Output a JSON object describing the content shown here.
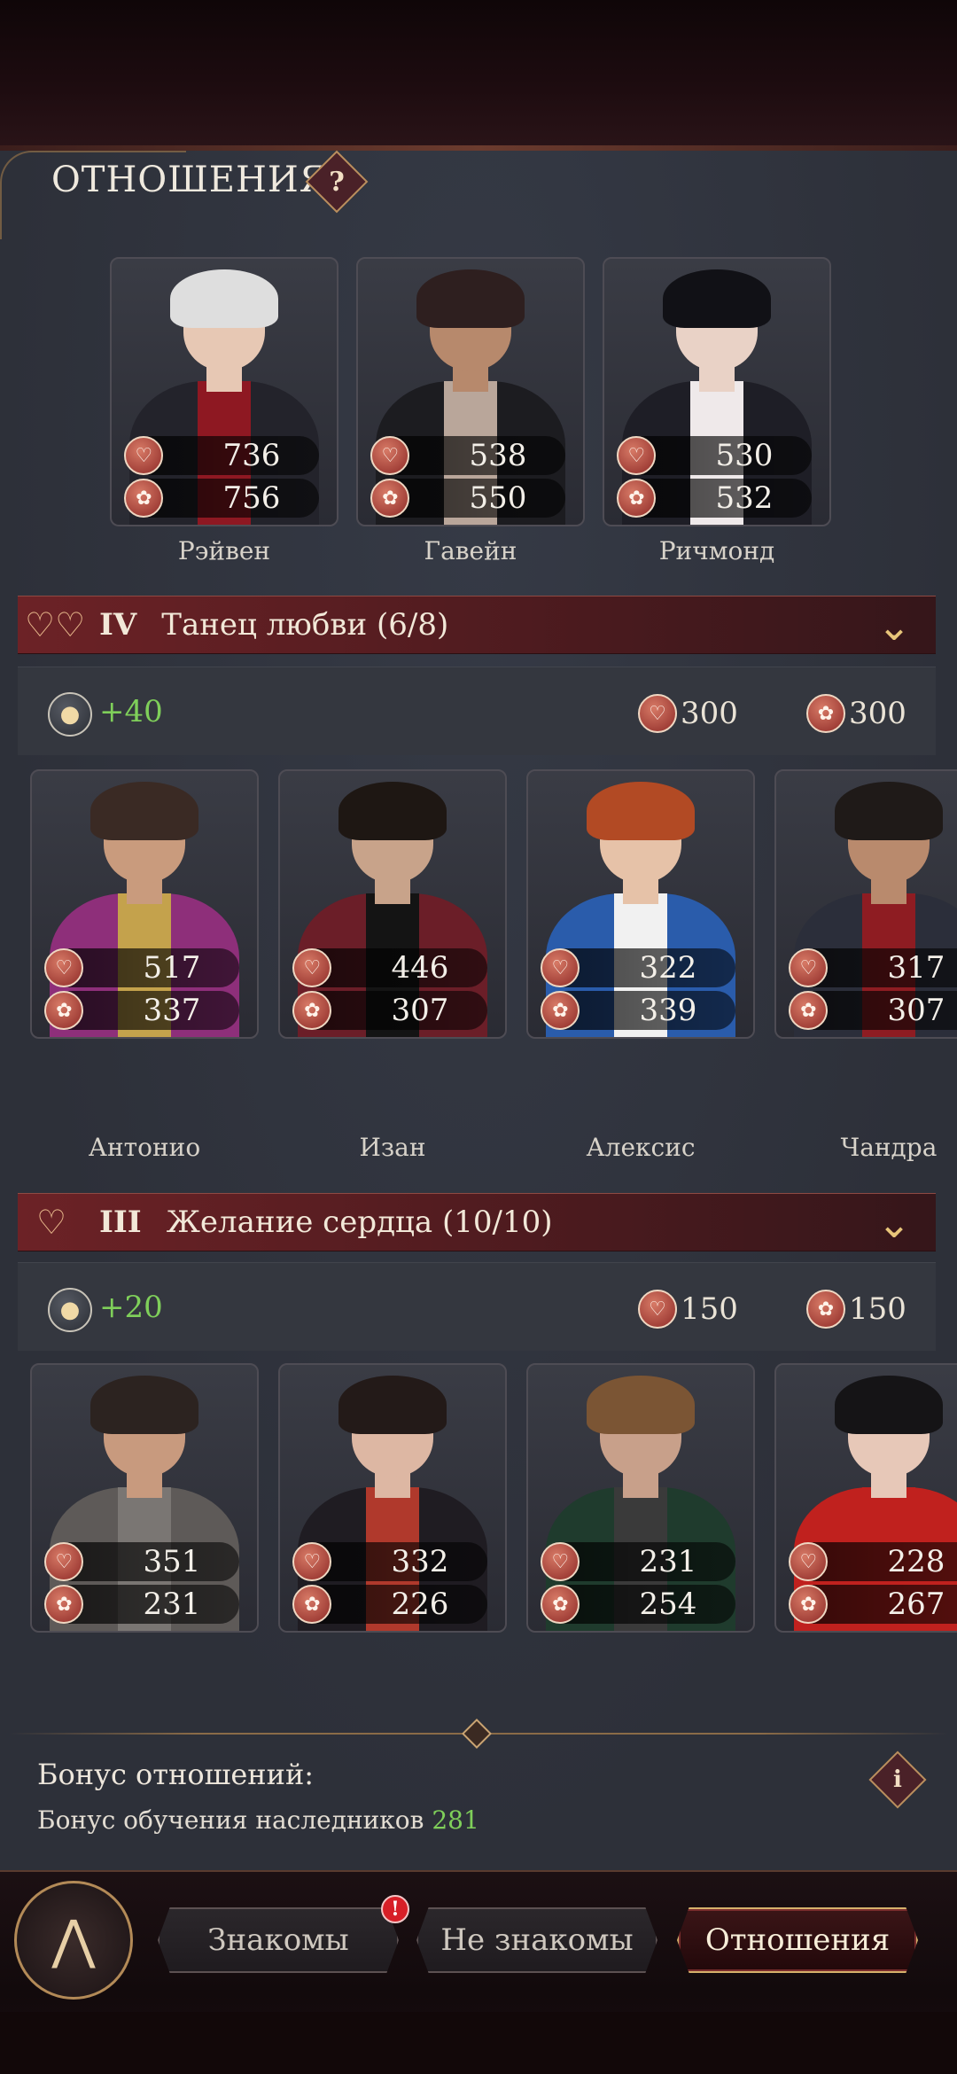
{
  "header": {
    "title": "ОТНОШЕНИЯ",
    "help_icon": "?"
  },
  "top_row": [
    {
      "name": "Рэйвен",
      "affection": "736",
      "rose": "756",
      "hair": "#dedede",
      "skin": "#e7c8b4",
      "outfit": "#23232b",
      "shirt": "#8e1822"
    },
    {
      "name": "Гавейн",
      "affection": "538",
      "rose": "550",
      "hair": "#2e1f1f",
      "skin": "#b7896c",
      "outfit": "#1c1c20",
      "shirt": "#b9a69a"
    },
    {
      "name": "Ричмонд",
      "affection": "530",
      "rose": "532",
      "hair": "#111116",
      "skin": "#e9d2c6",
      "outfit": "#1e1e26",
      "shirt": "#efe9ea"
    }
  ],
  "section4": {
    "roman": "IV",
    "title": "Танец любви (6/8)",
    "bonus": "+40",
    "req_affection": "300",
    "req_rose": "300",
    "cards": [
      {
        "name": "Антонио",
        "affection": "517",
        "rose": "337",
        "hair": "#3a2a24",
        "skin": "#c99b7d",
        "outfit": "#8e2f7a",
        "shirt": "#c4a24c"
      },
      {
        "name": "Изан",
        "affection": "446",
        "rose": "307",
        "hair": "#1e1713",
        "skin": "#c8a38a",
        "outfit": "#6b1e28",
        "shirt": "#141414"
      },
      {
        "name": "Алексис",
        "affection": "322",
        "rose": "339",
        "hair": "#b24a24",
        "skin": "#e6c2a8",
        "outfit": "#2a5cab",
        "shirt": "#f1f1f1"
      },
      {
        "name": "Чандра",
        "affection": "317",
        "rose": "307",
        "hair": "#1f1a18",
        "skin": "#b98a6d",
        "outfit": "#2b2e3a",
        "shirt": "#8e1c22"
      }
    ]
  },
  "section3": {
    "roman": "III",
    "title": "Желание сердца (10/10)",
    "bonus": "+20",
    "req_affection": "150",
    "req_rose": "150",
    "cards": [
      {
        "name": "",
        "affection": "351",
        "rose": "231",
        "hair": "#2c2320",
        "skin": "#c89a7e",
        "outfit": "#5e5a58",
        "shirt": "#7a7673"
      },
      {
        "name": "",
        "affection": "332",
        "rose": "226",
        "hair": "#231a18",
        "skin": "#ddb7a3",
        "outfit": "#1f1c22",
        "shirt": "#b0392c"
      },
      {
        "name": "",
        "affection": "231",
        "rose": "254",
        "hair": "#7b5534",
        "skin": "#c8a08a",
        "outfit": "#1f3b2d",
        "shirt": "#3a3a3a"
      },
      {
        "name": "",
        "affection": "228",
        "rose": "267",
        "hair": "#151416",
        "skin": "#e7c8b8",
        "outfit": "#c0211e",
        "shirt": "#c0211e"
      }
    ]
  },
  "bonus_info": {
    "title": "Бонус отношений:",
    "line_label": "Бонус обучения наследников",
    "line_value": "281",
    "info_icon": "i"
  },
  "nav": {
    "tabs": [
      "Знакомы",
      "Не знакомы",
      "Отношения"
    ],
    "active": "Отношения",
    "alert": "!"
  },
  "colors": {
    "accent_red": "#6c2226",
    "gold": "#d6b16b",
    "green": "#7fcf5a"
  },
  "icons": [
    "help-icon",
    "hearts-icon",
    "chevron-down-icon",
    "head-icon",
    "affection-icon",
    "rose-icon",
    "info-icon",
    "emblem-icon"
  ]
}
